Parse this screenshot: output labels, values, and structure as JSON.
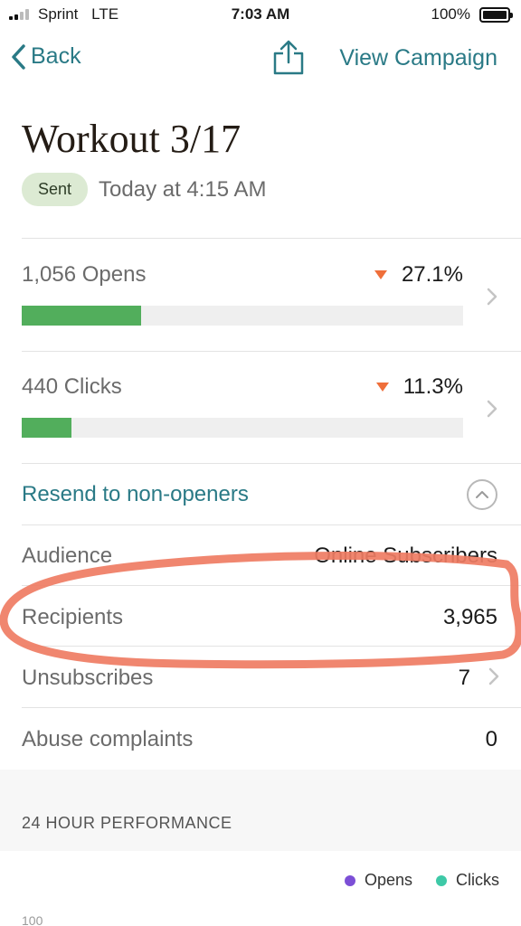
{
  "status_bar": {
    "carrier": "Sprint",
    "network": "LTE",
    "time": "7:03 AM",
    "battery": "100%"
  },
  "nav": {
    "back_label": "Back",
    "view_campaign_label": "View Campaign",
    "share_icon": "share-icon"
  },
  "campaign": {
    "title": "Workout 3/17",
    "status_badge": "Sent",
    "sent_time": "Today at 4:15 AM"
  },
  "stats": [
    {
      "label": "1,056 Opens",
      "rate": "27.1%",
      "fill_percent": 27.1,
      "trend": "down"
    },
    {
      "label": "440 Clicks",
      "rate": "11.3%",
      "fill_percent": 11.3,
      "trend": "down"
    }
  ],
  "resend_label": "Resend to non-openers",
  "details": [
    {
      "label": "Audience",
      "value": "Online Subscribers"
    },
    {
      "label": "Recipients",
      "value": "3,965"
    },
    {
      "label": "Unsubscribes",
      "value": "7"
    },
    {
      "label": "Abuse complaints",
      "value": "0"
    }
  ],
  "performance": {
    "section_title": "24 HOUR PERFORMANCE",
    "legend": [
      {
        "name": "Opens",
        "color": "#7c4fd6"
      },
      {
        "name": "Clicks",
        "color": "#3ec9a7"
      }
    ],
    "y_tick_top": "100"
  },
  "colors": {
    "accent": "#2a7a86",
    "bar_fill": "#52ae5c",
    "trend_down": "#ef6f3a",
    "annotation": "#ef7c63"
  }
}
